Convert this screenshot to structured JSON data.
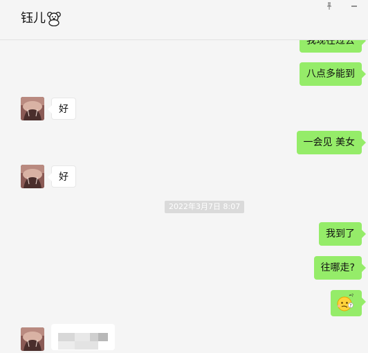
{
  "header": {
    "title": "钰儿",
    "title_icon": "teddy-bear-icon",
    "pin_icon": "pin-icon",
    "minimize_icon": "minimize-icon"
  },
  "messages": [
    {
      "side": "right",
      "text": "我现在过去"
    },
    {
      "side": "right",
      "text": "八点多能到"
    },
    {
      "side": "left",
      "text": "好"
    },
    {
      "side": "right",
      "text": "一会见 美女"
    },
    {
      "side": "left",
      "text": "好"
    },
    {
      "side": "time",
      "text": "2022年3月7日 8:07"
    },
    {
      "side": "right",
      "text": "我到了"
    },
    {
      "side": "right",
      "text": "往哪走?"
    },
    {
      "side": "right",
      "type": "emoji",
      "icon": "confused-face-icon"
    },
    {
      "side": "left",
      "type": "blurred-content"
    }
  ],
  "colors": {
    "right_bubble": "#95ec69",
    "left_bubble": "#ffffff",
    "background": "#f5f5f5",
    "timestamp_bg": "#dadada"
  }
}
